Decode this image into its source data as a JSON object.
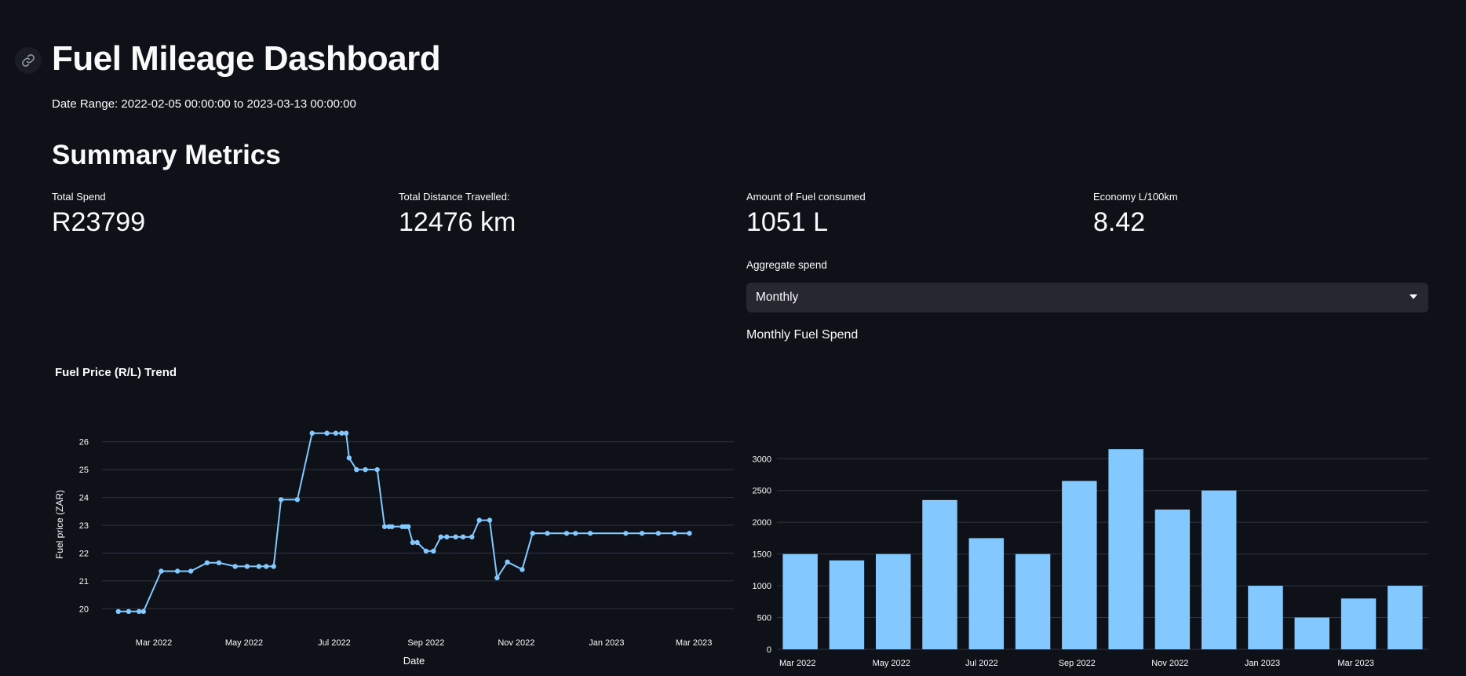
{
  "header": {
    "title": "Fuel Mileage Dashboard",
    "date_range": "Date Range: 2022-02-05 00:00:00 to 2023-03-13 00:00:00",
    "link_icon": "link-icon"
  },
  "summary": {
    "heading": "Summary Metrics",
    "metrics": [
      {
        "label": "Total Spend",
        "value": "R23799"
      },
      {
        "label": "Total Distance Travelled:",
        "value": "12476 km"
      },
      {
        "label": "Amount of Fuel consumed",
        "value": "1051 L"
      },
      {
        "label": "Economy L/100km",
        "value": "8.42"
      }
    ]
  },
  "aggregate": {
    "label": "Aggregate spend",
    "selected": "Monthly"
  },
  "colors": {
    "background": "#0e1117",
    "series": "#83c9ff",
    "grid": "#31333f",
    "select_bg": "#262730"
  },
  "chart_data": [
    {
      "type": "line",
      "title": "Fuel Price (R/L) Trend",
      "xlabel": "Date",
      "ylabel": "Fuel price (ZAR)",
      "ylim": [
        19.5,
        26.5
      ],
      "yticks": [
        "20",
        "21",
        "22",
        "23",
        "24",
        "25",
        "26"
      ],
      "xticks": [
        "Mar 2022",
        "May 2022",
        "Jul 2022",
        "Sep 2022",
        "Nov 2022",
        "Jan 2023",
        "Mar 2023"
      ],
      "xtick_dates": [
        "2022-03-01",
        "2022-05-01",
        "2022-07-01",
        "2022-09-01",
        "2022-11-01",
        "2023-01-01",
        "2023-03-01"
      ],
      "xlim": [
        "2022-01-25",
        "2023-03-28"
      ],
      "grid": true,
      "series": [
        {
          "x": [
            "2022-02-05",
            "2022-02-12",
            "2022-02-19",
            "2022-02-22",
            "2022-03-06",
            "2022-03-17",
            "2022-03-26",
            "2022-04-06",
            "2022-04-14",
            "2022-04-25",
            "2022-05-03",
            "2022-05-11",
            "2022-05-16",
            "2022-05-21",
            "2022-05-26",
            "2022-06-06",
            "2022-06-16",
            "2022-06-26",
            "2022-07-02",
            "2022-07-06",
            "2022-07-09",
            "2022-07-11",
            "2022-07-16",
            "2022-07-22",
            "2022-07-30",
            "2022-08-04",
            "2022-08-07",
            "2022-08-09",
            "2022-08-16",
            "2022-08-18",
            "2022-08-20",
            "2022-08-23",
            "2022-08-26",
            "2022-09-01",
            "2022-09-06",
            "2022-09-11",
            "2022-09-15",
            "2022-09-21",
            "2022-09-26",
            "2022-10-02",
            "2022-10-07",
            "2022-10-14",
            "2022-10-19",
            "2022-10-26",
            "2022-11-05",
            "2022-11-12",
            "2022-11-22",
            "2022-12-05",
            "2022-12-11",
            "2022-12-21",
            "2023-01-14",
            "2023-01-25",
            "2023-02-05",
            "2023-02-16",
            "2023-02-26"
          ],
          "y": [
            19.9,
            19.9,
            19.9,
            19.9,
            21.35,
            21.35,
            21.35,
            21.65,
            21.65,
            21.52,
            21.52,
            21.52,
            21.52,
            21.52,
            23.92,
            23.92,
            26.31,
            26.31,
            26.31,
            26.31,
            26.31,
            25.42,
            25.0,
            25.0,
            25.0,
            22.95,
            22.95,
            22.95,
            22.95,
            22.95,
            22.95,
            22.38,
            22.38,
            22.07,
            22.07,
            22.58,
            22.58,
            22.58,
            22.58,
            22.58,
            23.18,
            23.18,
            21.11,
            21.68,
            21.41,
            22.71,
            22.71,
            22.71,
            22.71,
            22.71,
            22.71,
            22.71,
            22.71,
            22.71,
            22.71
          ]
        }
      ]
    },
    {
      "type": "bar",
      "title": "Monthly Fuel Spend",
      "xlabel": "",
      "ylabel": "",
      "ylim": [
        0,
        3300
      ],
      "yticks": [
        "0",
        "500",
        "1000",
        "1500",
        "2000",
        "2500",
        "3000"
      ],
      "categories": [
        "Mar 2022",
        "",
        "May 2022",
        "",
        "Jul 2022",
        "",
        "Sep 2022",
        "",
        "Nov 2022",
        "",
        "Jan 2023",
        "",
        "Mar 2023",
        ""
      ],
      "values": [
        1500,
        1400,
        1500,
        2350,
        1750,
        1500,
        2650,
        3150,
        2200,
        2500,
        1000,
        500,
        800,
        1000
      ],
      "grid": true
    }
  ]
}
